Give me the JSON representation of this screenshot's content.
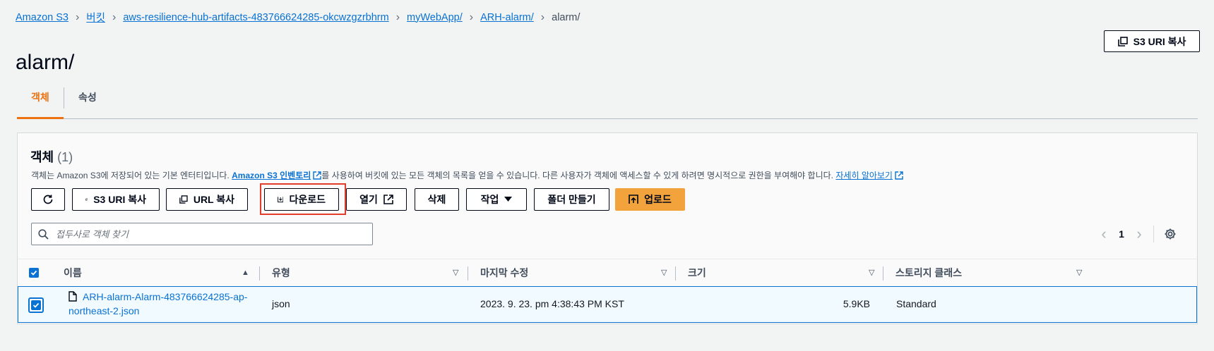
{
  "breadcrumb": {
    "items": [
      "Amazon S3",
      "버킷",
      "aws-resilience-hub-artifacts-483766624285-okcwzgzrbhrm",
      "myWebApp/",
      "ARH-alarm/"
    ],
    "current": "alarm/"
  },
  "page": {
    "title": "alarm/",
    "copy_uri_label": "S3 URI 복사"
  },
  "tabs": [
    {
      "label": "객체",
      "active": true
    },
    {
      "label": "속성",
      "active": false
    }
  ],
  "panel": {
    "title": "객체",
    "count": "(1)",
    "desc_prefix": "객체는 Amazon S3에 저장되어 있는 기본 엔터티입니다.",
    "desc_link1": "Amazon S3 인벤토리",
    "desc_middle": "를 사용하여 버킷에 있는 모든 객체의 목록을 얻을 수 있습니다. 다른 사용자가 객체에 액세스할 수 있게 하려면 명시적으로 권한을 부여해야 합니다.",
    "desc_link2": "자세히 알아보기"
  },
  "toolbar": {
    "copy_s3_uri": "S3 URI 복사",
    "copy_url": "URL 복사",
    "download": "다운로드",
    "open": "열기",
    "delete": "삭제",
    "actions": "작업",
    "create_folder": "폴더 만들기",
    "upload": "업로드"
  },
  "search": {
    "placeholder": "접두사로 객체 찾기"
  },
  "pager": {
    "page": "1"
  },
  "table": {
    "columns": [
      "이름",
      "유형",
      "마지막 수정",
      "크기",
      "스토리지 클래스"
    ],
    "rows": [
      {
        "name": "ARH-alarm-Alarm-483766624285-ap-northeast-2.json",
        "type": "json",
        "modified": "2023. 9. 23. pm 4:38:43 PM KST",
        "size": "5.9KB",
        "storage_class": "Standard",
        "selected": true
      }
    ]
  },
  "colors": {
    "accent": "#ec7211",
    "link": "#0972d3",
    "primary_button": "#f3a33c",
    "highlight_box": "#e33c2a"
  }
}
